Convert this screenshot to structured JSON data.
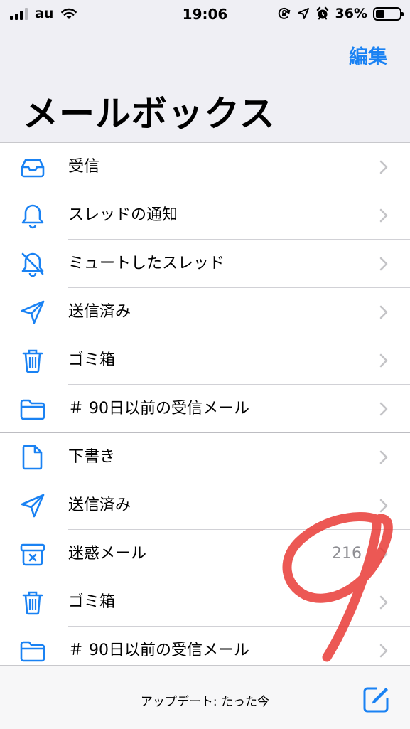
{
  "status_bar": {
    "carrier": "au",
    "time": "19:06",
    "battery_percent": "36%",
    "battery_level": 0.36
  },
  "header": {
    "edit_label": "編集",
    "title": "メールボックス"
  },
  "section1": [
    {
      "icon": "inbox-icon",
      "label": "受信"
    },
    {
      "icon": "bell-icon",
      "label": "スレッドの通知"
    },
    {
      "icon": "bell-slash-icon",
      "label": "ミュートしたスレッド"
    },
    {
      "icon": "paperplane-icon",
      "label": "送信済み"
    },
    {
      "icon": "trash-icon",
      "label": "ゴミ箱"
    },
    {
      "icon": "folder-icon",
      "label": "＃ 90日以前の受信メール"
    }
  ],
  "section2": [
    {
      "icon": "document-icon",
      "label": "下書き"
    },
    {
      "icon": "paperplane-icon",
      "label": "送信済み"
    },
    {
      "icon": "junk-icon",
      "label": "迷惑メール",
      "count": "216"
    },
    {
      "icon": "trash-icon",
      "label": "ゴミ箱"
    },
    {
      "icon": "folder-icon",
      "label": "＃ 90日以前の受信メール"
    }
  ],
  "bottom_bar": {
    "update_text": "アップデート: たった今"
  },
  "colors": {
    "accent": "#1a82f3",
    "header_bg": "#efeff4",
    "scribble": "#e8332e"
  }
}
